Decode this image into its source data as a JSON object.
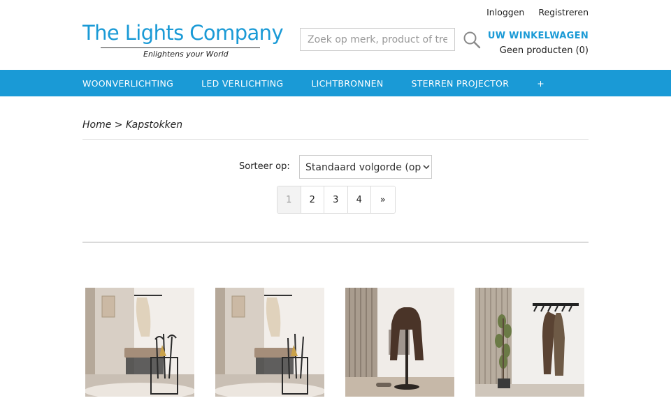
{
  "brand": {
    "name": "The Lights Company",
    "tagline": "Enlightens your World"
  },
  "top_links": {
    "login": "Inloggen",
    "register": "Registreren"
  },
  "search": {
    "placeholder": "Zoek op merk, product of trefwoord",
    "icon": "search-icon"
  },
  "cart": {
    "title": "UW WINKELWAGEN",
    "count_text": "Geen producten (0)"
  },
  "nav": {
    "items": [
      "WOONVERLICHTING",
      "LED VERLICHTING",
      "LICHTBRONNEN",
      "STERREN PROJECTOR",
      "+"
    ]
  },
  "breadcrumb": {
    "text": "Home > Kapstokken"
  },
  "sort": {
    "label": "Sorteer op:",
    "selected": "Standaard volgorde (oplopend)"
  },
  "pagination": {
    "pages": [
      "1",
      "2",
      "3",
      "4",
      "»"
    ],
    "current": "1"
  },
  "colors": {
    "accent": "#1a9ad6",
    "nav_text": "#ffffff"
  },
  "products": [
    {
      "image": "umbrella-stand-hallway-image"
    },
    {
      "image": "umbrella-stand-hallway-image"
    },
    {
      "image": "valet-stand-with-jacket-image"
    },
    {
      "image": "wall-coat-rack-image"
    }
  ]
}
